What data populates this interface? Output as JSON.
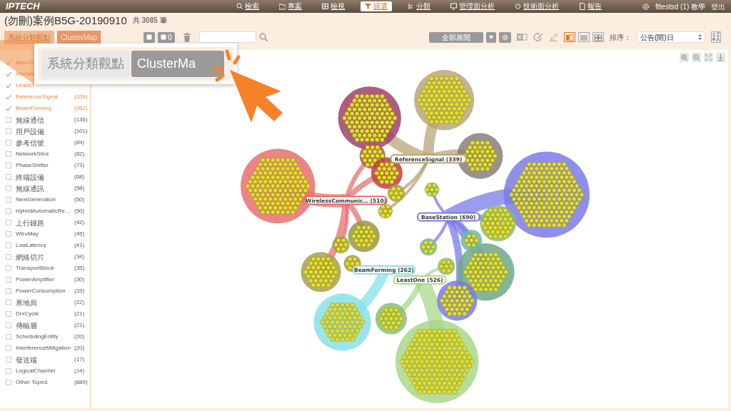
{
  "nav": {
    "logo": "IPTECH",
    "items": [
      {
        "label": "檢索",
        "selected": false
      },
      {
        "label": "專案",
        "selected": false
      },
      {
        "label": "檢視",
        "selected": false
      },
      {
        "label": "篩選",
        "selected": true
      },
      {
        "label": "分類",
        "selected": false
      },
      {
        "label": "管理面分析",
        "selected": false
      },
      {
        "label": "技術面分析",
        "selected": false
      },
      {
        "label": "報告",
        "selected": false
      }
    ],
    "user": "fttestsd (1) 教學",
    "logout": "登出"
  },
  "header": {
    "title": "(勿刪)案例B5G-20190910",
    "count": "共 3085 筆"
  },
  "toolbar": {
    "view_tabs": [
      {
        "label": "系統分類觀點",
        "selected": false
      },
      {
        "label": "ClusterMap",
        "selected": true
      }
    ],
    "counter": "0",
    "expand_button": "全部展開",
    "layouts": [
      {
        "selected": true
      },
      {
        "selected": false
      },
      {
        "selected": false
      }
    ],
    "sort_label": "排序：",
    "sort_value": "公告(開)日"
  },
  "callout": {
    "tabs": [
      {
        "label": "系統分類觀點",
        "selected": false
      },
      {
        "label": "ClusterMa",
        "selected": true
      }
    ]
  },
  "topics": [
    {
      "label": "BaseSt",
      "checked": true
    },
    {
      "label": "Wireles",
      "checked": true
    },
    {
      "label": "LeastO",
      "checked": true
    },
    {
      "label": "ReferenceSignal",
      "count": "(339)",
      "checked": true
    },
    {
      "label": "BeamForming",
      "count": "(262)",
      "checked": true
    },
    {
      "label": "無線通信",
      "count": "(136)",
      "checked": false
    },
    {
      "label": "用戶設備",
      "count": "(101)",
      "checked": false
    },
    {
      "label": "參考信號",
      "count": "(89)",
      "checked": false
    },
    {
      "label": "NetworkSlice",
      "count": "(82)",
      "checked": false
    },
    {
      "label": "PhaseShifter",
      "count": "(73)",
      "checked": false
    },
    {
      "label": "終端設備",
      "count": "(68)",
      "checked": false
    },
    {
      "label": "無線通訊",
      "count": "(58)",
      "checked": false
    },
    {
      "label": "NextGeneration",
      "count": "(50)",
      "checked": false
    },
    {
      "label": "HybridAutomaticRe...",
      "count": "(50)",
      "checked": false
    },
    {
      "label": "上行鏈路",
      "count": "(42)",
      "checked": false
    },
    {
      "label": "WtruMay",
      "count": "(45)",
      "checked": false
    },
    {
      "label": "LowLatency",
      "count": "(41)",
      "checked": false
    },
    {
      "label": "網絡切片",
      "count": "(34)",
      "checked": false
    },
    {
      "label": "TransportBlock",
      "count": "(35)",
      "checked": false
    },
    {
      "label": "PowerAmplifier",
      "count": "(30)",
      "checked": false
    },
    {
      "label": "PowerConsumption",
      "count": "(33)",
      "checked": false
    },
    {
      "label": "基地局",
      "count": "(22)",
      "checked": false
    },
    {
      "label": "DrxCycle",
      "count": "(21)",
      "checked": false
    },
    {
      "label": "傳輸層",
      "count": "(21)",
      "checked": false
    },
    {
      "label": "SchedulingEntity",
      "count": "(20)",
      "checked": false
    },
    {
      "label": "InterferenceMitigation",
      "count": "(20)",
      "checked": false
    },
    {
      "label": "發送端",
      "count": "(17)",
      "checked": false
    },
    {
      "label": "LogicalChannel",
      "count": "(14)",
      "checked": false
    },
    {
      "label": "Other Topics",
      "count": "(889)",
      "checked": false
    }
  ],
  "map": {
    "labels": [
      {
        "text": "ReferenceSignal (339)",
        "color": "#b8a67a"
      },
      {
        "text": "WirelessCommunic… (510)",
        "color": "#e87070"
      },
      {
        "text": "BaseStation (690)",
        "color": "#7b7be8"
      },
      {
        "text": "BeamForming (262)",
        "color": "#88e0e8"
      },
      {
        "text": "LeastOne (526)",
        "color": "#a8d88a"
      }
    ]
  }
}
